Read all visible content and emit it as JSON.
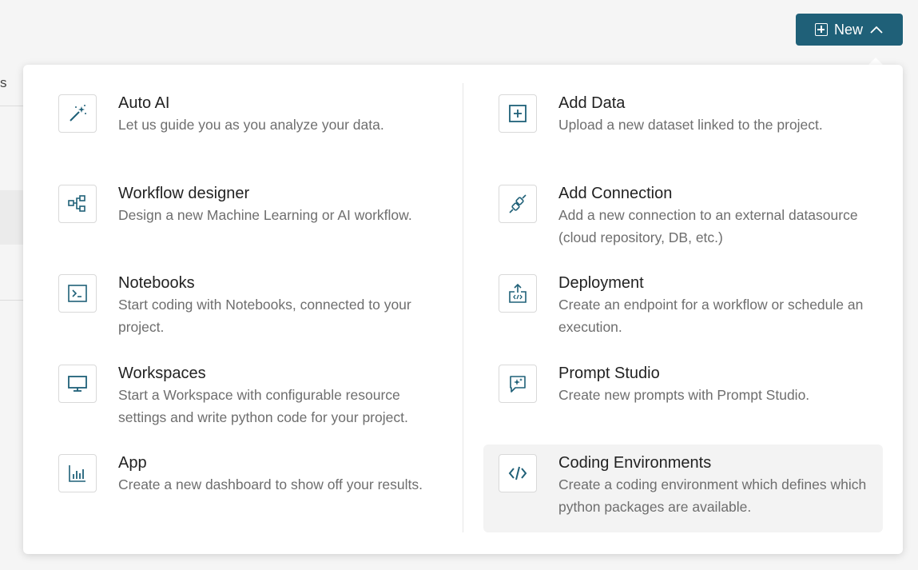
{
  "background": {
    "edge_text": "s"
  },
  "header": {
    "new_button_label": "New"
  },
  "menu": {
    "left_items": [
      {
        "title": "Auto AI",
        "description": "Let us guide you as you analyze your data.",
        "icon": "magic-wand-icon"
      },
      {
        "title": "Workflow designer",
        "description": "Design a new Machine Learning or AI workflow.",
        "icon": "workflow-icon"
      },
      {
        "title": "Notebooks",
        "description": "Start coding with Notebooks, connected to your project.",
        "icon": "terminal-icon"
      },
      {
        "title": "Workspaces",
        "description": "Start a Workspace with configurable resource settings and write python code for your project.",
        "icon": "monitor-icon"
      },
      {
        "title": "App",
        "description": "Create a new dashboard to show off your results.",
        "icon": "bar-chart-icon"
      }
    ],
    "right_items": [
      {
        "title": "Add Data",
        "description": "Upload a new dataset linked to the project.",
        "icon": "add-box-icon"
      },
      {
        "title": "Add Connection",
        "description": "Add a new connection to an external datasource (cloud repository, DB, etc.)",
        "icon": "plug-icon"
      },
      {
        "title": "Deployment",
        "description": "Create an endpoint for a workflow or schedule an execution.",
        "icon": "deploy-icon"
      },
      {
        "title": "Prompt Studio",
        "description": "Create new prompts with Prompt Studio.",
        "icon": "chat-sparkle-icon"
      },
      {
        "title": "Coding Environments",
        "description": "Create a coding environment which defines which python packages are available.",
        "icon": "code-icon"
      }
    ]
  },
  "colors": {
    "accent": "#1f6078",
    "icon": "#1f6078",
    "hover_bg": "#f3f3f3"
  }
}
